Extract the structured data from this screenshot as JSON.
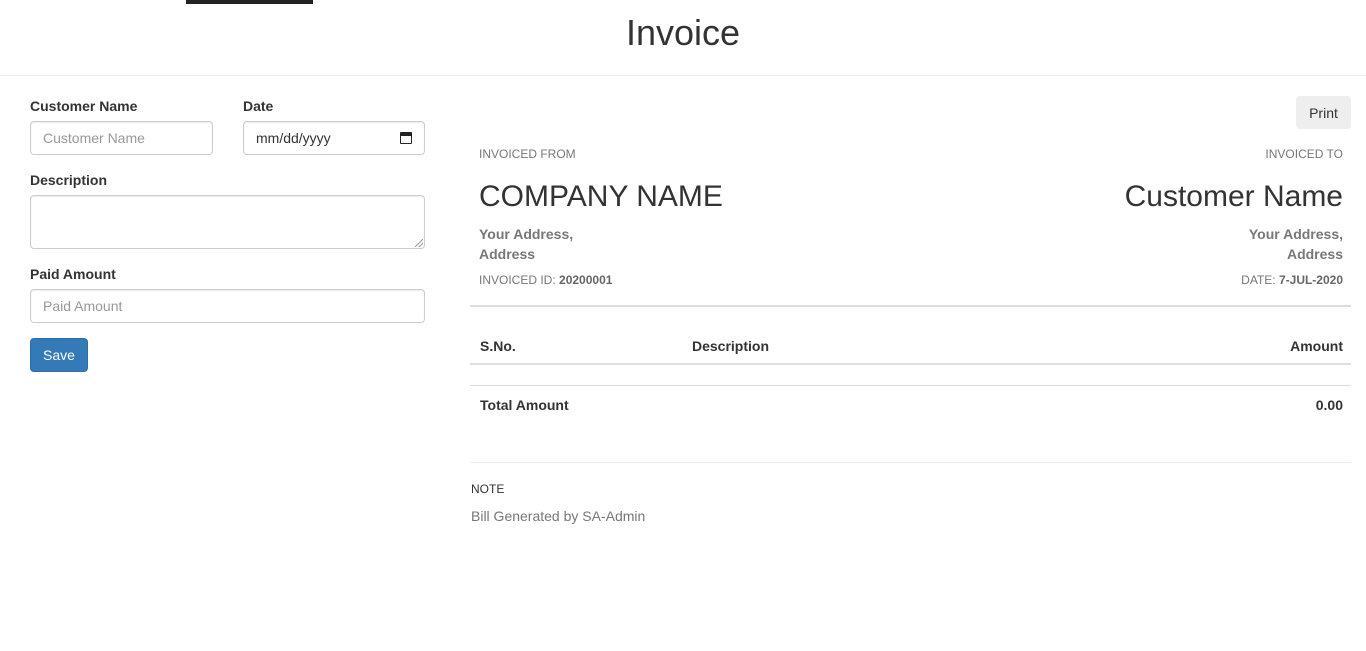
{
  "header": {
    "title": "Invoice"
  },
  "form": {
    "customer_name_label": "Customer Name",
    "customer_name_placeholder": "Customer Name",
    "customer_name_value": "",
    "date_label": "Date",
    "date_value": "mm/dd/yyyy",
    "description_label": "Description",
    "description_value": "",
    "paid_amount_label": "Paid Amount",
    "paid_amount_placeholder": "Paid Amount",
    "paid_amount_value": "",
    "save_label": "Save"
  },
  "invoice": {
    "print_label": "Print",
    "from_label": "INVOICED FROM",
    "to_label": "INVOICED TO",
    "company_name": "COMPANY NAME",
    "customer_name": "Customer Name",
    "from_address_line1": "Your Address,",
    "from_address_line2": "Address",
    "to_address_line1": "Your Address,",
    "to_address_line2": "Address",
    "invoice_id_label": "INVOICED ID:",
    "invoice_id": "20200001",
    "date_label": "DATE:",
    "date": "7-JUL-2020",
    "table": {
      "columns": [
        "S.No.",
        "Description",
        "Amount"
      ],
      "rows": [],
      "total_label": "Total Amount",
      "total_value": "0.00"
    },
    "note_label": "NOTE",
    "note_text": "Bill Generated by SA-Admin"
  }
}
